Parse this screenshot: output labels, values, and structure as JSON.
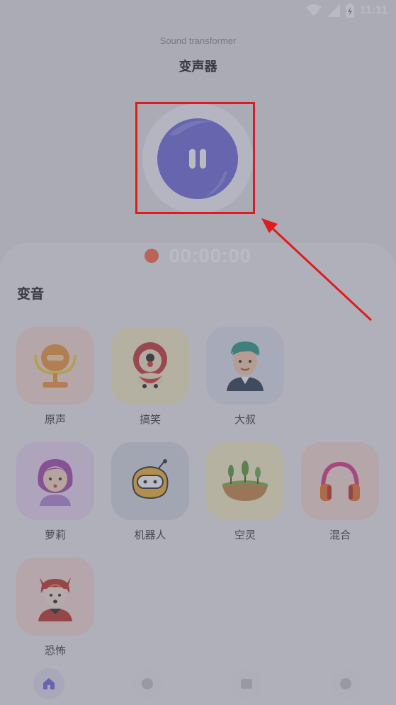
{
  "status_bar": {
    "time": "11:11",
    "icons": [
      "wifi-icon",
      "signal-icon",
      "battery-icon"
    ]
  },
  "header": {
    "subtitle": "Sound transformer",
    "title": "变声器"
  },
  "recorder": {
    "state": "paused",
    "icon": "pause-icon",
    "timer": "00:00:00"
  },
  "section": {
    "title": "变音"
  },
  "voices": [
    {
      "label": "原声",
      "icon": "microphone-icon",
      "bg": "#f6ddd6"
    },
    {
      "label": "搞笑",
      "icon": "clown-icon",
      "bg": "#f4efc9"
    },
    {
      "label": "大叔",
      "icon": "uncle-icon",
      "bg": "#dee6ef"
    },
    {
      "label": "萝莉",
      "icon": "girl-icon",
      "bg": "#ead9f4"
    },
    {
      "label": "机器人",
      "icon": "robot-icon",
      "bg": "#d6dce6"
    },
    {
      "label": "空灵",
      "icon": "landscape-icon",
      "bg": "#f6f1c8"
    },
    {
      "label": "混合",
      "icon": "headphones-icon",
      "bg": "#f6ddd6"
    },
    {
      "label": "恐怖",
      "icon": "devil-icon",
      "bg": "#f4dcd8"
    }
  ],
  "bottom_nav": [
    "home-icon",
    "voice-icon",
    "photo-icon",
    "profile-icon"
  ],
  "colors": {
    "accent": "#6f6ddd",
    "record": "#ff6a4a",
    "highlight": "#e01b1b"
  }
}
